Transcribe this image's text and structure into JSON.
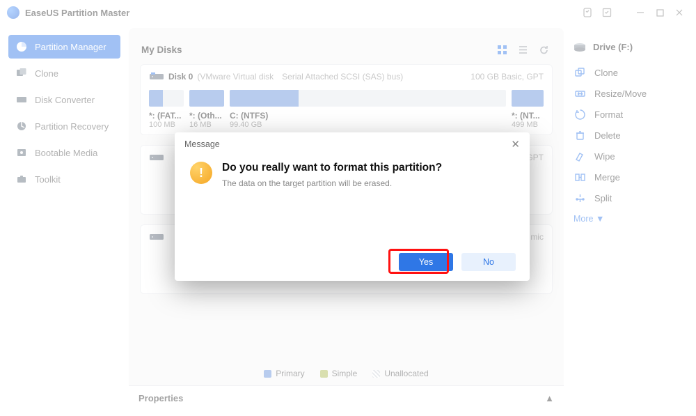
{
  "titlebar": {
    "title": "EaseUS Partition Master"
  },
  "sidebar": {
    "items": [
      {
        "label": "Partition Manager"
      },
      {
        "label": "Clone"
      },
      {
        "label": "Disk Converter"
      },
      {
        "label": "Partition Recovery"
      },
      {
        "label": "Bootable Media"
      },
      {
        "label": "Toolkit"
      }
    ]
  },
  "center": {
    "header": "My Disks",
    "disk0": {
      "name": "Disk 0",
      "vendor": "(VMware   Virtual disk",
      "bus": "Serial Attached SCSI (SAS) bus)",
      "right": "100 GB Basic, GPT"
    },
    "parts": [
      {
        "label": "*: (FAT...",
        "size": "100 MB"
      },
      {
        "label": "*: (Oth...",
        "size": "16 MB"
      },
      {
        "label": "C: (NTFS)",
        "size": "99.40 GB"
      },
      {
        "label": "*: (NT...",
        "size": "499 MB"
      }
    ],
    "legend": {
      "p": "Primary",
      "s": "Simple",
      "u": "Unallocated"
    },
    "properties": "Properties"
  },
  "right": {
    "drive": "Drive (F:)",
    "items": [
      {
        "label": "Clone"
      },
      {
        "label": "Resize/Move"
      },
      {
        "label": "Format"
      },
      {
        "label": "Delete"
      },
      {
        "label": "Wipe"
      },
      {
        "label": "Merge"
      },
      {
        "label": "Split"
      }
    ],
    "more": "More  ▼"
  },
  "dialog": {
    "title": "Message",
    "heading": "Do you really want to format this partition?",
    "sub": "The data on the target partition will be erased.",
    "yes": "Yes",
    "no": "No"
  },
  "hidden": {
    "gpt": "GPT",
    "mic": "mic"
  }
}
